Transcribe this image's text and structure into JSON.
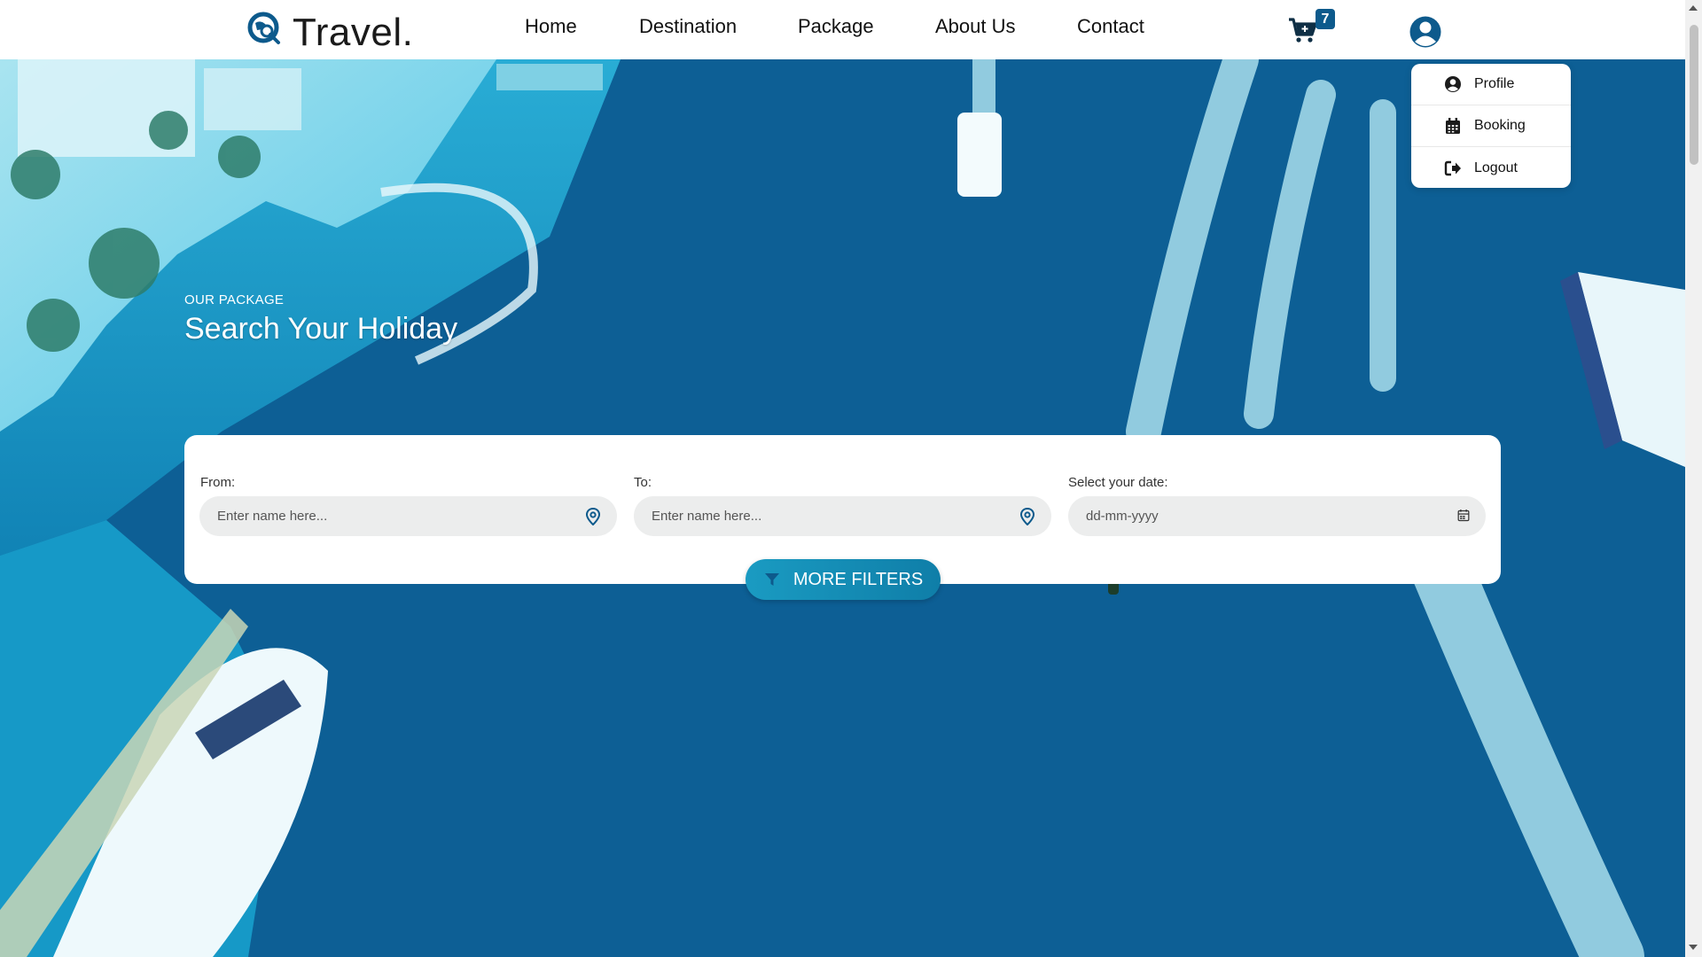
{
  "brand": {
    "name": "Travel."
  },
  "nav": {
    "items": [
      {
        "label": "Home"
      },
      {
        "label": "Destination"
      },
      {
        "label": "Package"
      },
      {
        "label": "About Us"
      },
      {
        "label": "Contact"
      }
    ]
  },
  "cart": {
    "count": "7",
    "icon": "cart-plus-icon"
  },
  "user_menu": {
    "icon": "user-circle-icon",
    "items": [
      {
        "label": "Profile",
        "icon": "user-circle-icon"
      },
      {
        "label": "Booking",
        "icon": "calendar-icon"
      },
      {
        "label": "Logout",
        "icon": "logout-icon"
      }
    ]
  },
  "hero": {
    "eyebrow": "OUR PACKAGE",
    "title": "Search Your Holiday"
  },
  "search": {
    "from_label": "From:",
    "from_placeholder": "Enter name here...",
    "to_label": "To:",
    "to_placeholder": "Enter name here...",
    "date_label": "Select your date:",
    "date_placeholder": "dd-mm-yyyy",
    "filters_button": "MORE FILTERS"
  },
  "colors": {
    "accent": "#0d5a8c",
    "button": "#1a9bc2",
    "ocean": "#0f5e93"
  }
}
